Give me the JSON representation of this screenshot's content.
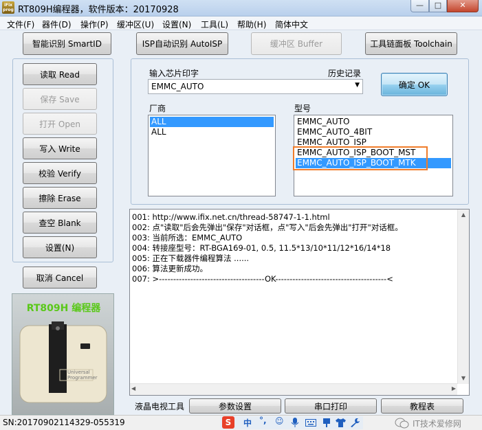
{
  "window": {
    "title": "RT809H编程器，软件版本：20170928",
    "icon_text": "iFix prog",
    "controls": {
      "minimize": "—",
      "maximize": "□",
      "close": "✕"
    }
  },
  "menu": [
    {
      "label": "文件(F)"
    },
    {
      "label": "器件(D)"
    },
    {
      "label": "操作(P)"
    },
    {
      "label": "缓冲区(U)"
    },
    {
      "label": "设置(N)"
    },
    {
      "label": "工具(L)"
    },
    {
      "label": "帮助(H)"
    },
    {
      "label": "简体中文"
    }
  ],
  "toolbar": {
    "smart_id": "智能识别 SmartID",
    "isp_auto": "ISP自动识别 AutoISP",
    "buffer": "缓冲区 Buffer",
    "toolchain": "工具链面板 Toolchain"
  },
  "side_buttons": [
    {
      "label": "读取 Read",
      "enabled": true
    },
    {
      "label": "保存 Save",
      "enabled": false
    },
    {
      "label": "打开 Open",
      "enabled": false
    },
    {
      "label": "写入 Write",
      "enabled": true
    },
    {
      "label": "校验 Verify",
      "enabled": true
    },
    {
      "label": "擦除 Erase",
      "enabled": true
    },
    {
      "label": "查空 Blank",
      "enabled": true
    },
    {
      "label": "设置(N)",
      "enabled": true
    }
  ],
  "cancel_label": "取消 Cancel",
  "product": {
    "label": "RT809H 编程器",
    "device_text": "Universal Programmer"
  },
  "chip_input": {
    "label": "输入芯片印字",
    "history_label": "历史记录",
    "value": "EMMC_AUTO",
    "ok_label": "确定 OK"
  },
  "vendor": {
    "label": "厂商",
    "items": [
      "ALL",
      "ALL"
    ],
    "selected": 0
  },
  "model": {
    "label": "型号",
    "items": [
      "EMMC_AUTO",
      "EMMC_AUTO_4BIT",
      "EMMC_AUTO_ISP",
      "EMMC_AUTO_ISP_BOOT_MST",
      "EMMC_AUTO_ISP_BOOT_MTK"
    ],
    "selected": 4,
    "highlight_color": "#f07c2a"
  },
  "log_lines": [
    "001:  http://www.ifix.net.cn/thread-58747-1-1.html",
    "002:  点\"读取\"后会先弹出\"保存\"对话框，点\"写入\"后会先弹出\"打开\"对话框。",
    "003:  当前所选：EMMC_AUTO",
    "004:  转接座型号：RT-BGA169-01, 0.5, 11.5*13/10*11/12*16/14*18",
    "005:  正在下载器件编程算法 ......",
    "006:  算法更新成功。",
    "007:  >-------------------------------------OK---------------------------------------<"
  ],
  "bottom": {
    "lcd_tool": "液晶电视工具",
    "params": "参数设置",
    "serial_print": "串口打印",
    "tutorial": "教程表"
  },
  "status": {
    "sn": "SN:20170902114329-055319",
    "ime_icons": [
      "S",
      "中",
      "°,",
      "☺",
      "mic",
      "keyboard",
      "skin",
      "shirt",
      "wrench"
    ],
    "watermark": "IT技术爱修网"
  },
  "colors": {
    "selection": "#3399ff",
    "accent_orange": "#f07c2a",
    "product_text": "#5ac81a"
  }
}
